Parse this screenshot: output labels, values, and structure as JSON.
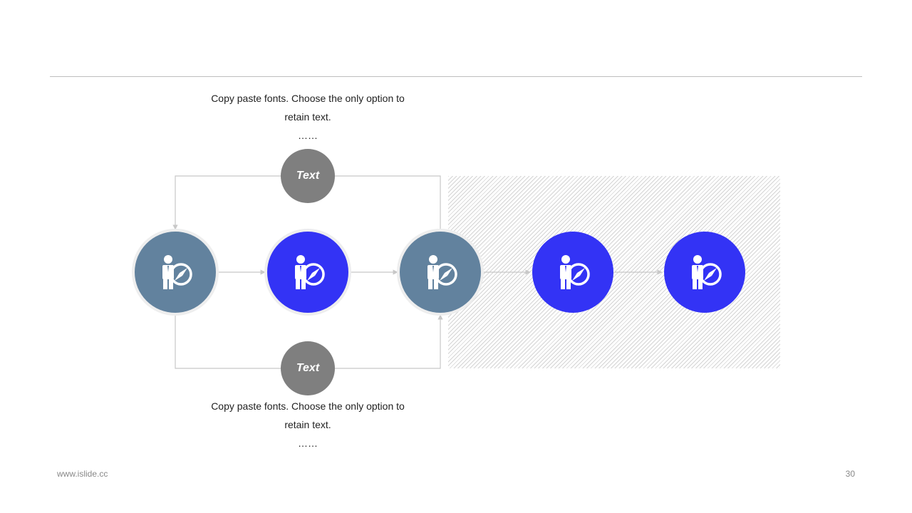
{
  "top_description": {
    "line1": "Copy paste fonts. Choose the only option to",
    "line2": "retain text.",
    "ellipsis": "……"
  },
  "bottom_description": {
    "line1": "Copy paste fonts. Choose the only option to",
    "line2": "retain text.",
    "ellipsis": "……"
  },
  "top_bubble_label": "Text",
  "bottom_bubble_label": "Text",
  "nodes": [
    {
      "icon": "person-compass-icon",
      "color": "#62829e"
    },
    {
      "icon": "person-compass-icon",
      "color": "#3333f5"
    },
    {
      "icon": "person-compass-icon",
      "color": "#62829e"
    },
    {
      "icon": "person-compass-icon",
      "color": "#3333f5"
    },
    {
      "icon": "person-compass-icon",
      "color": "#3333f5"
    }
  ],
  "colors": {
    "slate": "#62829e",
    "blue": "#3333f5",
    "bubble_gray": "#7f7f7f",
    "connector": "#c8c8c8"
  },
  "footer": {
    "url": "www.islide.cc",
    "page_number": "30"
  }
}
